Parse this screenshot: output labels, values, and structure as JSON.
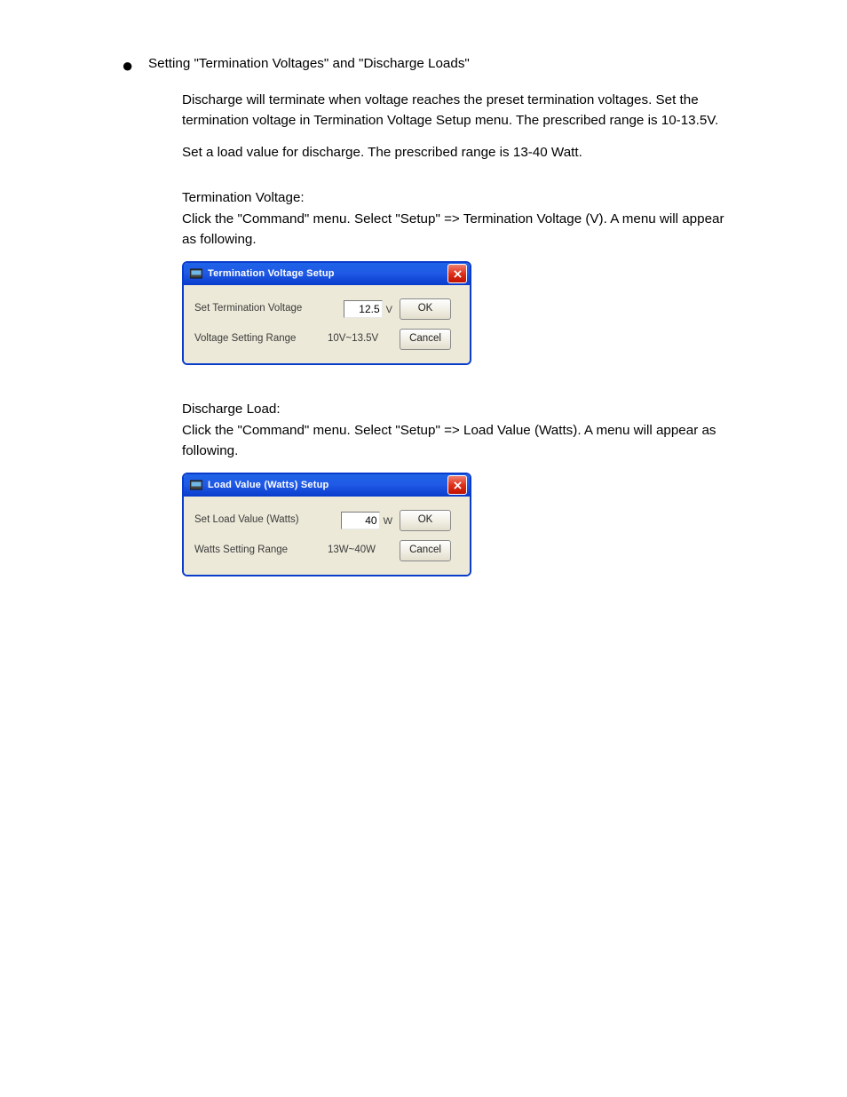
{
  "doc": {
    "bullet1": "Setting \"Termination Voltages\" and \"Discharge Loads\"",
    "para1": "Discharge will terminate when voltage reaches the preset termination voltages. Set the termination voltage in Termination Voltage Setup menu. The prescribed range is 10-13.5V.",
    "para2": "Set a load value for discharge. The prescribed range is 13-40 Watt.",
    "voltage": {
      "line1": "Termination Voltage:",
      "line2": "Click the \"Command\" menu. Select \"Setup\" => Termination Voltage (V). A menu will appear as following."
    },
    "load": {
      "line1": "Discharge Load:",
      "line2": "Click the \"Command\" menu. Select \"Setup\" => Load Value (Watts). A menu will appear as following."
    }
  },
  "dialog_voltage": {
    "title": "Termination Voltage Setup",
    "label_set": "Set Termination Voltage",
    "value": "12.5",
    "unit": "V",
    "label_range": "Voltage Setting Range",
    "range": "10V~13.5V",
    "ok": "OK",
    "cancel": "Cancel"
  },
  "dialog_load": {
    "title": "Load Value (Watts) Setup",
    "label_set": "Set Load Value (Watts)",
    "value": "40",
    "unit": "W",
    "label_range": "Watts Setting Range",
    "range": "13W~40W",
    "ok": "OK",
    "cancel": "Cancel"
  }
}
